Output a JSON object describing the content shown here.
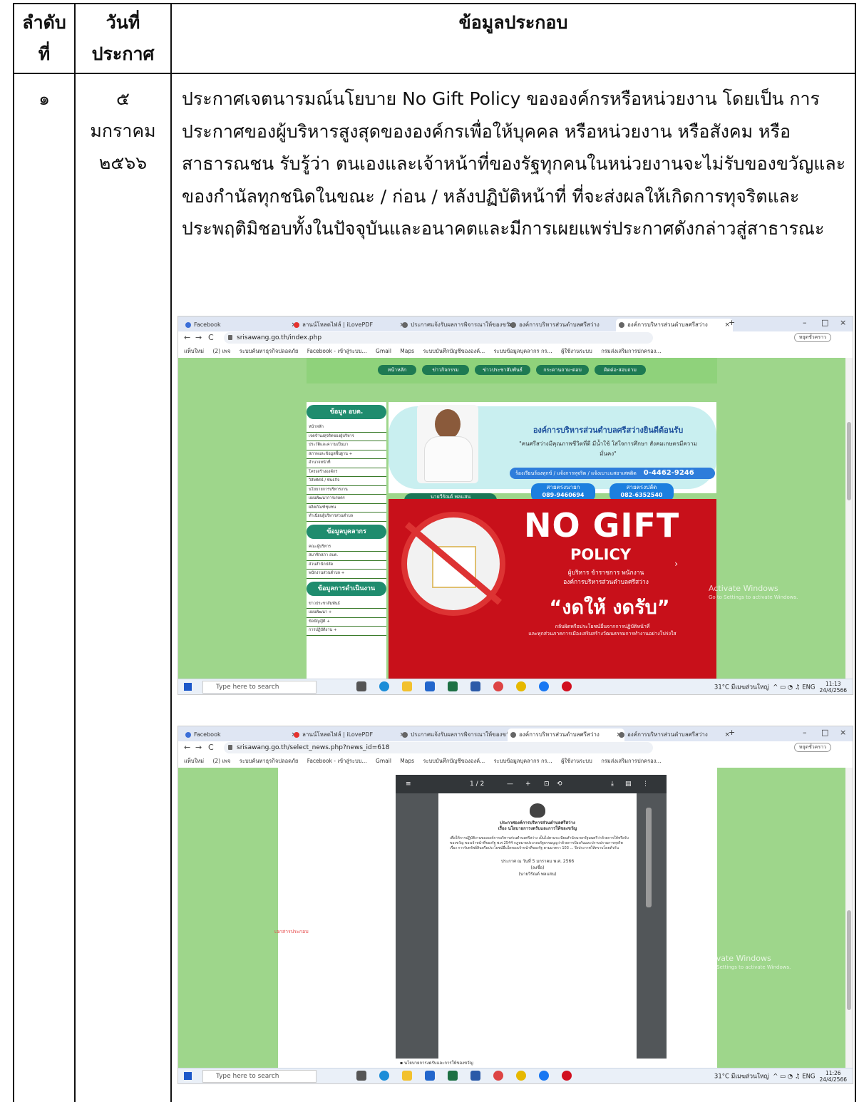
{
  "table": {
    "headers": {
      "order": "ลำดับ\nที่",
      "date": "วันที่\nประกาศ",
      "info": "ข้อมูลประกอบ"
    },
    "row1": {
      "order": "๑",
      "date": "๕\nมกราคม\n๒๕๖๖",
      "text": "ประกาศเจตนารมณ์นโยบาย No Gift Policy ขององค์กรหรือหน่วยงาน โดยเป็น การประกาศของผู้บริหารสูงสุดขององค์กรเพื่อให้บุคคล หรือหน่วยงาน หรือสังคม หรือสาธารณชน รับรู้ว่า ตนเองและเจ้าหน้าที่ของรัฐทุกคนในหน่วยงานจะไม่รับของขวัญและของกำนัลทุกชนิดในขณะ / ก่อน / หลังปฏิบัติหน้าที่ ที่จะส่งผลให้เกิดการทุจริตและประพฤติมิชอบทั้งในปัจจุบันและอนาคตและมีการเผยแพร่ประกาศดังกล่าวสู่สาธารณะ"
    }
  },
  "browser": {
    "tabs": [
      "Facebook",
      "ลานน์โหลดไฟล์ | iLovePDF",
      "ประกาศแจ้งรับผลการพิจารณาให้ของขวัญ",
      "องค์การบริหารส่วนตำบลศรีสว่าง",
      "องค์การบริหารส่วนตำบลศรีสว่าง"
    ],
    "profile": "หยุดชั่วคราว",
    "bookmarks": [
      "แท็บใหม่",
      "(2) เพจ",
      "ระบบค้นหาธุรกิจปลอดภัย",
      "Facebook - เข้าสู่ระบบ...",
      "Gmail",
      "Maps",
      "ระบบบันทึกบัญชีขององค์...",
      "ระบบข้อมูลบุคลากร กร...",
      "ผู้ใช้งานระบบ",
      "กรมส่งเสริมการปกครอง..."
    ],
    "search_placeholder": "Type here to search",
    "weather": "31°C มีเมฆส่วนใหญ่",
    "lang": "ENG"
  },
  "shot1": {
    "url": "srisawang.go.th/index.php",
    "time": "11:13",
    "date": "24/4/2566",
    "menu": [
      "หน้าหลัก",
      "ข่าวกิจกรรม",
      "ข่าวประชาสัมพันธ์",
      "กระดานถาม-ตอบ",
      "ติดต่อ-สอบถาม"
    ],
    "left_heads": [
      "ข้อมูล อบต.",
      "ข้อมูลบุคลากร",
      "ข้อมูลการดำเนินงาน"
    ],
    "left_items1": [
      "หน้าหลัก",
      "เจตจำนงสุจริตของผู้บริหาร",
      "ประวัติและความเป็นมา",
      "สภาพและข้อมูลพื้นฐาน +",
      "อำนาจหน้าที่",
      "โครงสร้างองค์กร",
      "วิสัยทัศน์ / พันธกิจ",
      "นโยบายการบริหารงาน",
      "แผนพัฒนาการเกษตร",
      "ผลิตภัณฑ์ชุมชน",
      "ทำเนียบผู้บริหารส่วนตำบล"
    ],
    "left_items2": [
      "คณะผู้บริหาร",
      "สมาชิกสภา อบต.",
      "ส่วนสำนักปลัด",
      "พนักงานส่วนตำบล +"
    ],
    "left_items3": [
      "ข่าวประชาสัมพันธ์",
      "แผนพัฒนา +",
      "ข้อบัญญัติ +",
      "การปฏิบัติงาน +"
    ],
    "welcome": "องค์การบริหารส่วนตำบลศรีสว่างยินดีต้อนรับ",
    "slogan": "\"คนศรีสว่างมีคุณภาพชีวิตที่ดี มีน้ำใช้ ใส่ใจการศึกษา สังคมเกษตรมีความมั่นคง\"",
    "hotline_label": "ร้องเรียนร้องทุกข์ / แจ้งการทุจริต / แจ้งเบาะแสยาเสพติด",
    "hotline": "0-4462-9246",
    "phone1_label": "สายตรงนายก",
    "phone1": "089-9460694",
    "phone2_label": "สายตรงปลัด",
    "phone2": "082-6352540",
    "nametag": "นายวีรัณต์ พลแสน\nนายกองค์การบริหารส่วนตำบลศรีสว่าง",
    "nogift_1": "NO GIFT",
    "nogift_2": "POLICY",
    "nogift_3": "ผู้บริหาร ข้าราชการ พนักงาน\nองค์การบริหารส่วนตำบลศรีสว่าง",
    "nogift_4": "“งดให้ งดรับ”",
    "nogift_5": "กลับผิดหรือประโยชน์อื่นจากการปฏิบัติหน้าที่\nและทุกส่วนภาคการเมืองเสริมสร้างวัฒนธรรมการทำงานอย่างโปร่งใส",
    "activate": "Activate Windows",
    "activate_sub": "Go to Settings to activate Windows."
  },
  "shot2": {
    "url": "srisawang.go.th/select_news.php?news_id=618",
    "time": "11:26",
    "date": "24/4/2566",
    "note": "เอกสารประกอบ",
    "pdf_page": "1 / 2",
    "doc_title": "ประกาศองค์การบริหารส่วนตำบลศรีสว่าง\nเรื่อง นโยบายการงดรับและการให้ของขวัญ",
    "doc_body": "เพื่อให้การปฏิบัติงานขององค์การบริหารส่วนตำบลศรีสว่าง เป็นไปตามระเบียบสำนักนายกรัฐมนตรีว่าด้วยการให้หรือรับของขวัญ ของเจ้าหน้าที่ของรัฐ พ.ศ.2544 กฎหมายประกอบรัฐธรรมนูญว่าด้วยการป้องกันและปราบปรามการทุจริต เรื่อง การรับทรัพย์สินหรือประโยชน์อื่นใดของเจ้าหน้าที่ของรัฐ ตามมาตรา 103 ... จึงประกาศให้ทราบโดยทั่วกัน",
    "doc_sign": "ประกาศ ณ วันที่ 5 มกราคม พ.ศ. 2566\n(ลงชื่อ)\n(นายวีรัณต์ พลแสน)",
    "pdf_file": "นโยบายการงดรับและการให้ของขวัญ",
    "activate": "Activate Windows",
    "activate_sub": "Go to Settings to activate Windows."
  }
}
